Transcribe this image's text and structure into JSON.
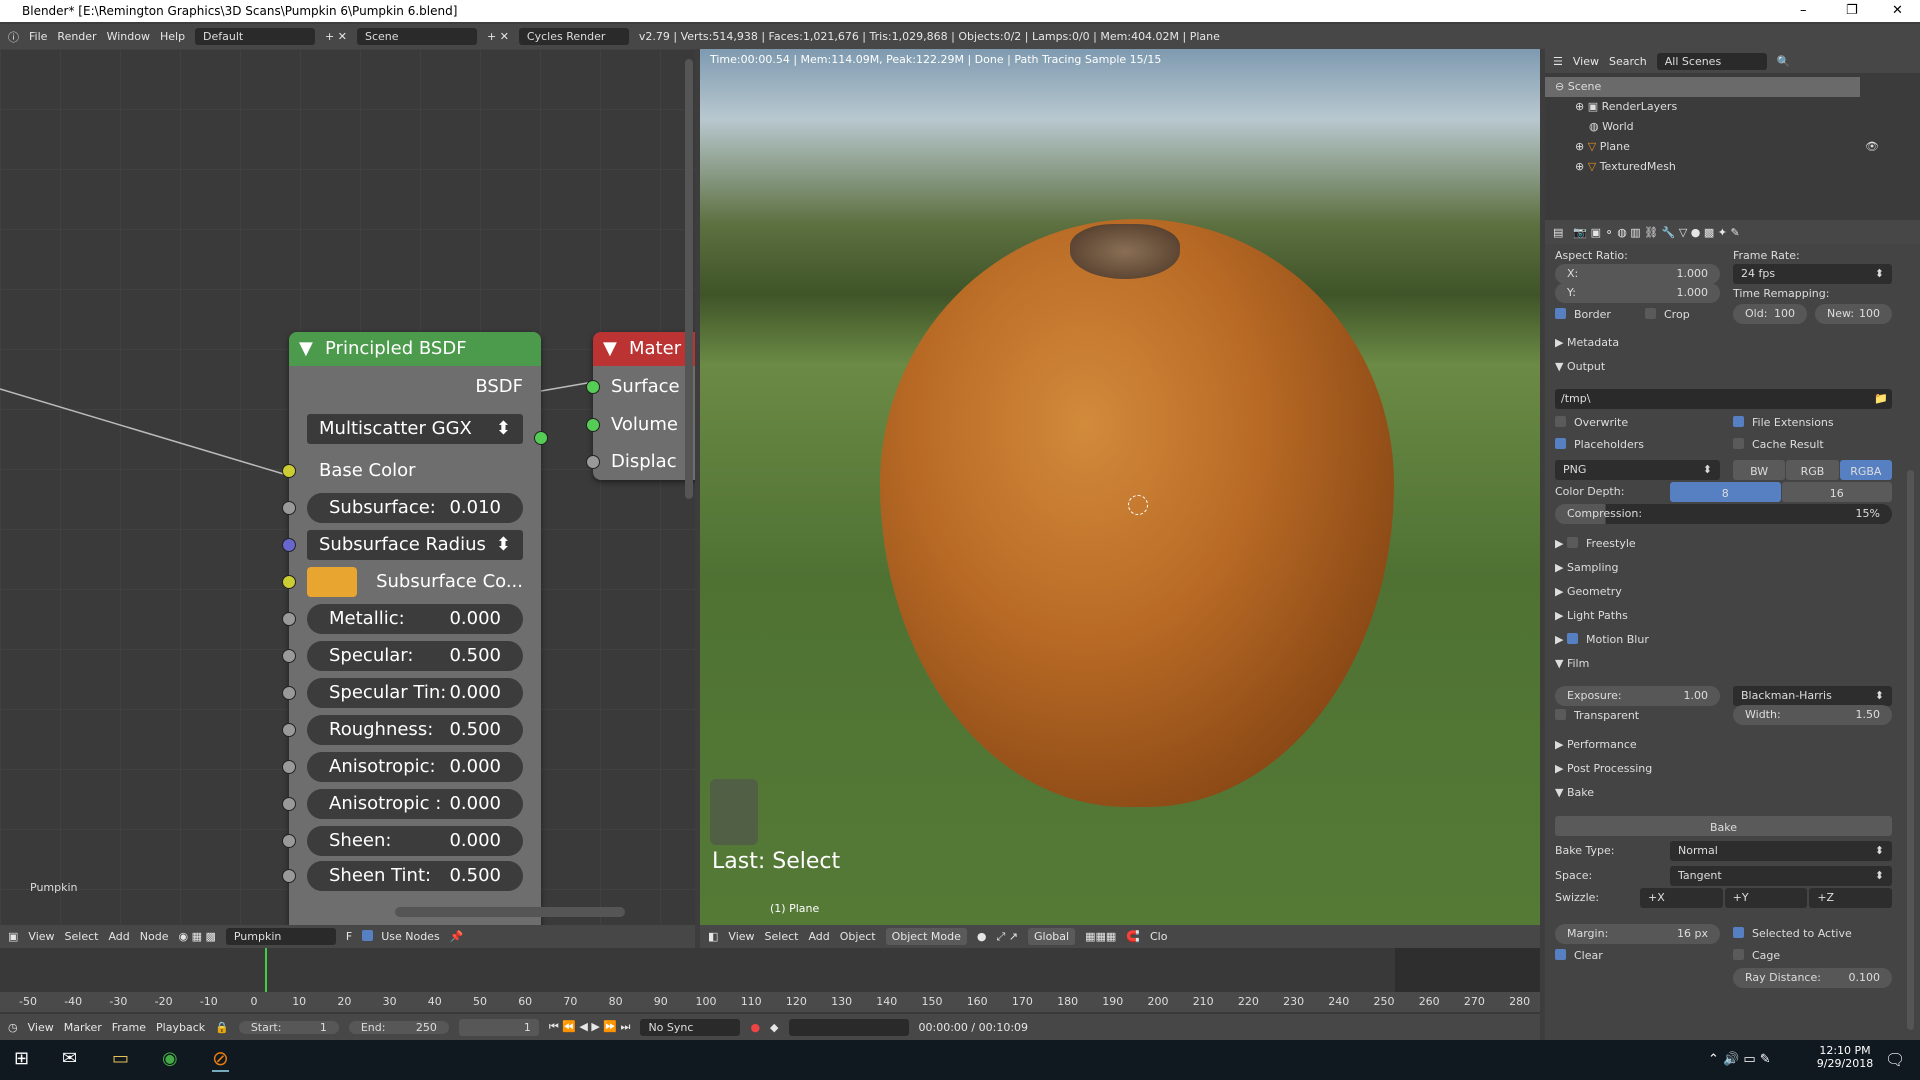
{
  "window": {
    "title": "Blender* [E:\\Remington Graphics\\3D Scans\\Pumpkin 6\\Pumpkin 6.blend]"
  },
  "topbar": {
    "menus": [
      "File",
      "Render",
      "Window",
      "Help"
    ],
    "layout": "Default",
    "scene": "Scene",
    "engine": "Cycles Render",
    "stats": "v2.79 | Verts:514,938 | Faces:1,021,676 | Tris:1,029,868 | Objects:0/2 | Lamps:0/0 | Mem:404.02M | Plane"
  },
  "render_status": "Time:00:00.54 | Mem:114.09M, Peak:122.29M | Done | Path Tracing Sample 15/15",
  "node_editor": {
    "material_label": "Pumpkin",
    "bsdf": {
      "title": "Principled BSDF",
      "output": "BSDF",
      "distribution": "Multiscatter GGX",
      "base_color": "Base Color",
      "subsurface_radius": "Subsurface Radius",
      "subsurface_color": "Subsurface Co...",
      "subsurface_color_hex": "#e8a630",
      "fields": [
        {
          "label": "Subsurface:",
          "value": "0.010"
        },
        {
          "label": "Metallic:",
          "value": "0.000"
        },
        {
          "label": "Specular:",
          "value": "0.500"
        },
        {
          "label": "Specular Tin:",
          "value": "0.000"
        },
        {
          "label": "Roughness:",
          "value": "0.500"
        },
        {
          "label": "Anisotropic:",
          "value": "0.000"
        },
        {
          "label": "Anisotropic :",
          "value": "0.000"
        },
        {
          "label": "Sheen:",
          "value": "0.000"
        },
        {
          "label": "Sheen Tint:",
          "value": "0.500"
        }
      ]
    },
    "output_node": {
      "title": "Mater",
      "inputs": [
        "Surface",
        "Volume",
        "Displac"
      ]
    },
    "header": {
      "menus": [
        "View",
        "Select",
        "Add",
        "Node"
      ],
      "material": "Pumpkin",
      "fake_user": "F",
      "use_nodes": "Use Nodes"
    }
  },
  "viewport": {
    "last_op": "Last: Select",
    "object_label": "(1) Plane",
    "header": {
      "menus": [
        "View",
        "Select",
        "Add",
        "Object"
      ],
      "mode": "Object Mode",
      "orientation": "Global",
      "trailing": "Clo"
    }
  },
  "outliner": {
    "menus": [
      "View",
      "Search"
    ],
    "filter": "All Scenes",
    "items": [
      "Scene",
      "RenderLayers",
      "World",
      "Plane",
      "TexturedMesh"
    ]
  },
  "properties": {
    "aspect_label": "Aspect Ratio:",
    "x": {
      "label": "X:",
      "value": "1.000"
    },
    "y": {
      "label": "Y:",
      "value": "1.000"
    },
    "frame_rate_label": "Frame Rate:",
    "frame_rate": "24 fps",
    "time_remap_label": "Time Remapping:",
    "old": {
      "label": "Old:",
      "value": "100"
    },
    "new": {
      "label": "New:",
      "value": "100"
    },
    "border": "Border",
    "crop": "Crop",
    "metadata": "Metadata",
    "output": "Output",
    "path": "/tmp\\",
    "overwrite": "Overwrite",
    "file_ext": "File Extensions",
    "placeholders": "Placeholders",
    "cache": "Cache Result",
    "format": "PNG",
    "color_modes": [
      "BW",
      "RGB",
      "RGBA"
    ],
    "color_depth_label": "Color Depth:",
    "depths": [
      "8",
      "16"
    ],
    "compression": {
      "label": "Compression:",
      "value": "15%",
      "fraction": 0.15
    },
    "sections": [
      "Freestyle",
      "Sampling",
      "Geometry",
      "Light Paths",
      "Motion Blur",
      "Film"
    ],
    "exposure": {
      "label": "Exposure:",
      "value": "1.00"
    },
    "filter": "Blackman-Harris",
    "width": {
      "label": "Width:",
      "value": "1.50"
    },
    "transparent": "Transparent",
    "sections2": [
      "Performance",
      "Post Processing",
      "Bake"
    ],
    "bake_button": "Bake",
    "bake_type": {
      "label": "Bake Type:",
      "value": "Normal"
    },
    "space": {
      "label": "Space:",
      "value": "Tangent"
    },
    "swizzle": {
      "label": "Swizzle:",
      "values": [
        "+X",
        "+Y",
        "+Z"
      ]
    },
    "margin": {
      "label": "Margin:",
      "value": "16 px"
    },
    "selected_to_active": "Selected to Active",
    "clear": "Clear",
    "cage": "Cage",
    "ray_distance": {
      "label": "Ray Distance:",
      "value": "0.100"
    }
  },
  "timeline": {
    "ticks": [
      "-50",
      "-40",
      "-30",
      "-20",
      "-10",
      "0",
      "10",
      "20",
      "30",
      "40",
      "50",
      "60",
      "70",
      "80",
      "90",
      "100",
      "110",
      "120",
      "130",
      "140",
      "150",
      "160",
      "170",
      "180",
      "190",
      "200",
      "210",
      "220",
      "230",
      "240",
      "250",
      "260",
      "270",
      "280"
    ],
    "menus": [
      "View",
      "Marker",
      "Frame",
      "Playback"
    ],
    "start": {
      "label": "Start:",
      "value": "1"
    },
    "end": {
      "label": "End:",
      "value": "250"
    },
    "current": "1",
    "sync": "No Sync",
    "time": "00:00:00 / 00:10:09"
  },
  "taskbar": {
    "time": "12:10 PM",
    "date": "9/29/2018"
  }
}
